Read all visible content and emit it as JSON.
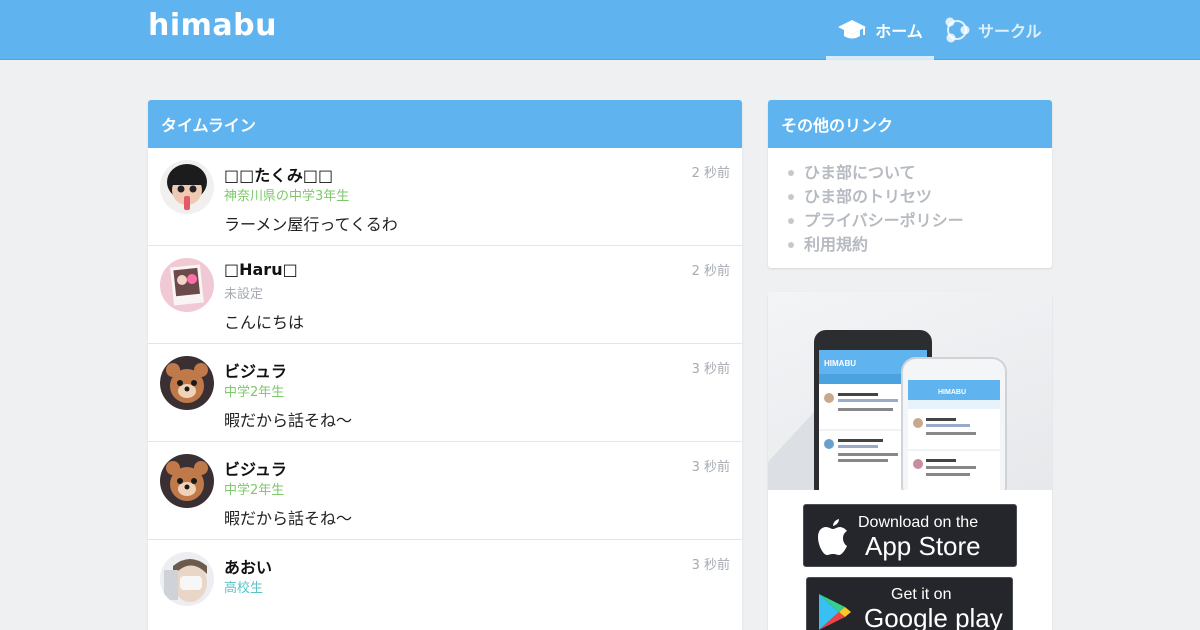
{
  "header": {
    "logo": "himabu",
    "nav": [
      {
        "label": "ホーム",
        "active": true,
        "icon": "graduation-cap-icon"
      },
      {
        "label": "サークル",
        "active": false,
        "icon": "circle-network-icon"
      }
    ],
    "color": "#5fb4ef"
  },
  "timeline": {
    "title": "タイムライン",
    "posts": [
      {
        "name": "□□たくみ□□",
        "grade": "神奈川県の中学3年生",
        "grade_color": "#7cc86a",
        "body": "ラーメン屋行ってくるわ",
        "time": "2 秒前",
        "avatar": "avatar-boy-icon"
      },
      {
        "name": "□Haru□",
        "grade": "未設定",
        "grade_color": "#a6abb1",
        "body": "こんにちは",
        "time": "2 秒前",
        "avatar": "avatar-photo-icon"
      },
      {
        "name": "ビジュラ",
        "grade": "中学2年生",
        "grade_color": "#7cc86a",
        "body": "暇だから話そね〜",
        "time": "3 秒前",
        "avatar": "avatar-bear-icon"
      },
      {
        "name": "ビジュラ",
        "grade": "中学2年生",
        "grade_color": "#7cc86a",
        "body": "暇だから話そね〜",
        "time": "3 秒前",
        "avatar": "avatar-bear-icon"
      },
      {
        "name": "あおい",
        "grade": "高校生",
        "grade_color": "#5bc3c8",
        "body": "",
        "time": "3 秒前",
        "avatar": "avatar-face-icon"
      }
    ]
  },
  "links": {
    "title": "その他のリンク",
    "items": [
      "ひま部について",
      "ひま部のトリセツ",
      "プライバシーポリシー",
      "利用規約"
    ]
  },
  "promo": {
    "phone_brand": "HIMABU",
    "app_store": {
      "small": "Download on the",
      "big": "App Store"
    },
    "google_play": {
      "small": "Get it on",
      "big": "Google play"
    }
  }
}
